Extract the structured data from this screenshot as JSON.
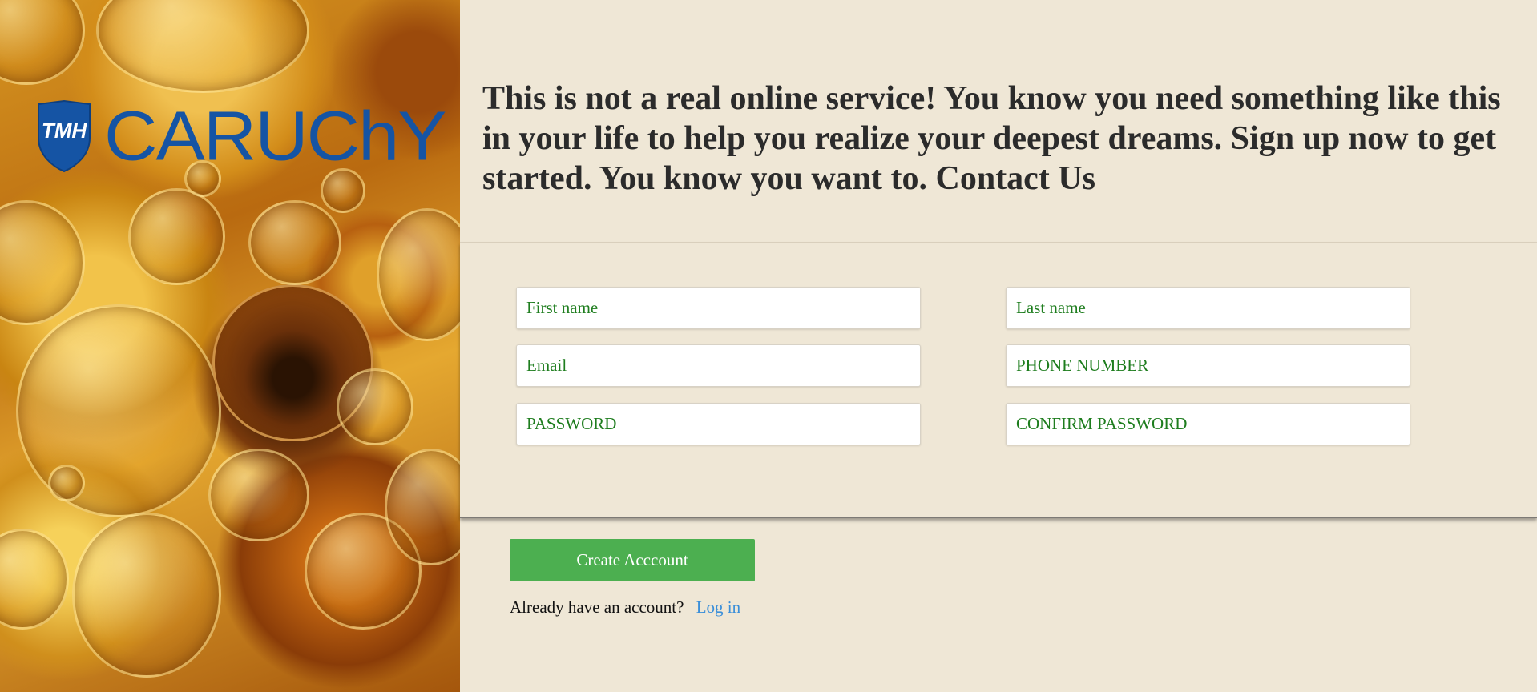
{
  "brand": {
    "logo_text": "CARUChY",
    "shield_text": "TMH",
    "colors": {
      "logo_blue": "#1554a4",
      "background": "#efe7d6",
      "accent_green": "#4caf50",
      "link_blue": "#3b8fd9",
      "placeholder_green": "#1e7d1e"
    }
  },
  "header": {
    "headline": "This is not a real online service! You know you need something like this in your life to help you realize your deepest dreams. Sign up now to get started. You know you want to. Contact Us"
  },
  "form": {
    "first_name_placeholder": "First name",
    "last_name_placeholder": "Last name",
    "email_placeholder": "Email",
    "phone_placeholder": "PHONE NUMBER",
    "password_placeholder": "PASSWORD",
    "confirm_password_placeholder": "CONFIRM PASSWORD"
  },
  "actions": {
    "create_label": "Create Acccount",
    "have_account_text": "Already have an account?",
    "login_label": "Log in"
  },
  "icons": {
    "shield": "shield-logo-icon"
  }
}
